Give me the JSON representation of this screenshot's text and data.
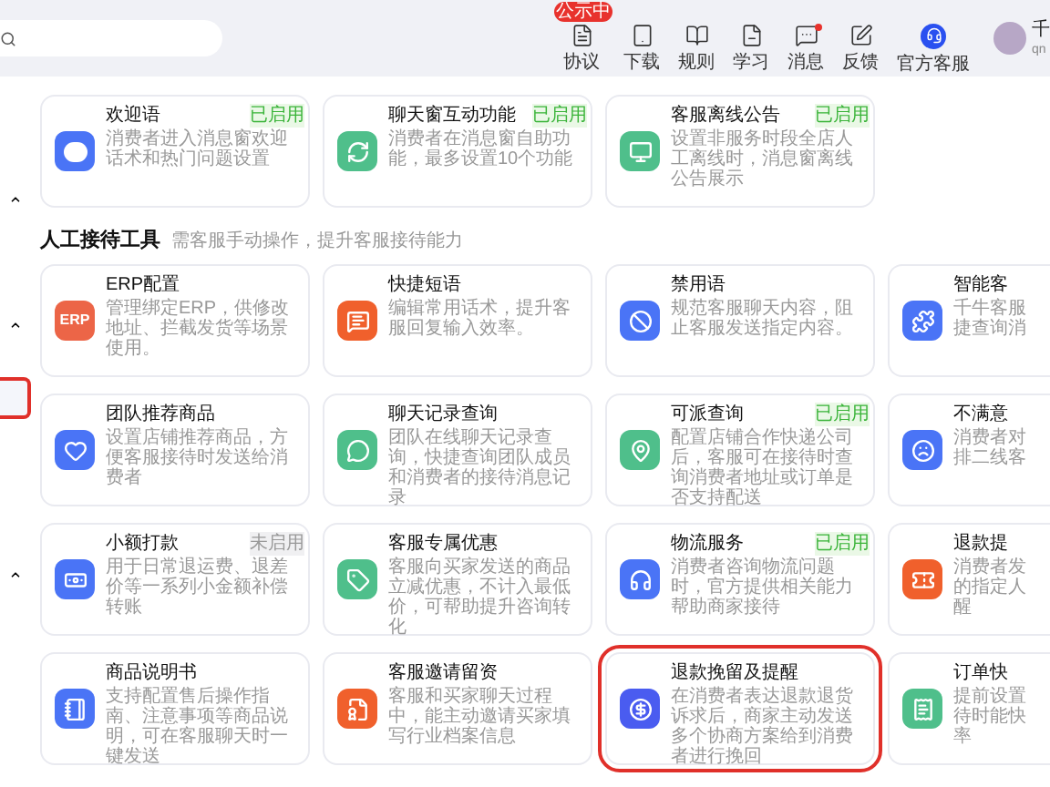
{
  "top_nav": [
    {
      "label": "协议",
      "badge": "公示中",
      "dot": false
    },
    {
      "label": "下载",
      "dot": false
    },
    {
      "label": "规则",
      "dot": false
    },
    {
      "label": "学习",
      "dot": false
    },
    {
      "label": "消息",
      "dot": true
    },
    {
      "label": "反馈",
      "dot": false
    },
    {
      "label": "官方客服",
      "dot": false
    }
  ],
  "user": {
    "name": "千",
    "account": "qn"
  },
  "sidebar": {
    "items": [
      {
        "selected": false
      },
      {
        "selected": false
      },
      {
        "selected": true
      },
      {
        "selected": false
      }
    ]
  },
  "top_cards": [
    {
      "title": "欢迎语",
      "desc": "消费者进入消息窗欢迎话术和热门问题设置",
      "status": "已启用",
      "enabled": true,
      "color": "#4a74f6",
      "highlighted": false
    },
    {
      "title": "聊天窗互动功能",
      "desc": "消费者在消息窗自助功能，最多设置10个功能",
      "status": "已启用",
      "enabled": true,
      "color": "#4fbf8b",
      "highlighted": false
    },
    {
      "title": "客服离线公告",
      "desc": "设置非服务时段全店人工离线时，消息窗离线公告展示",
      "status": "已启用",
      "enabled": true,
      "color": "#4fbf8b",
      "highlighted": false
    }
  ],
  "section": {
    "title": "人工接待工具",
    "subtitle": "需客服手动操作，提升客服接待能力"
  },
  "cards": [
    {
      "title": "ERP配置",
      "icon_text": "ERP",
      "desc": "管理绑定ERP，供修改地址、拦截发货等场景使用。",
      "color": "#ec6547",
      "highlighted": false
    },
    {
      "title": "快捷短语",
      "desc": "编辑常用话术，提升客服回复输入效率。",
      "color": "#f0602c",
      "highlighted": false
    },
    {
      "title": "禁用语",
      "desc": "规范客服聊天内容，阻止客服发送指定内容。",
      "color": "#4a74f6",
      "highlighted": false
    },
    {
      "title": "智能客",
      "desc": "千牛客服捷查询消",
      "color": "#4a74f6",
      "highlighted": false
    },
    {
      "title": "团队推荐商品",
      "desc": "设置店铺推荐商品，方便客服接待时发送给消费者",
      "color": "#4a74f6",
      "highlighted": false
    },
    {
      "title": "聊天记录查询",
      "desc": "团队在线聊天记录查询，快捷查询团队成员和消费者的接待消息记录",
      "color": "#4fbf8b",
      "highlighted": false
    },
    {
      "title": "可派查询",
      "desc": "配置店铺合作快递公司后，客服可在接待时查询消费者地址或订单是否支持配送",
      "status": "已启用",
      "enabled": true,
      "color": "#4fbf8b",
      "highlighted": false
    },
    {
      "title": "不满意",
      "desc": "消费者对排二线客",
      "color": "#4a74f6",
      "highlighted": false
    },
    {
      "title": "小额打款",
      "desc": "用于日常退运费、退差价等一系列小金额补偿转账",
      "status": "未启用",
      "enabled": false,
      "color": "#4a74f6",
      "highlighted": false
    },
    {
      "title": "客服专属优惠",
      "desc": "客服向买家发送的商品立减优惠，不计入最低价，可帮助提升咨询转化",
      "color": "#4fbf8b",
      "highlighted": false
    },
    {
      "title": "物流服务",
      "desc": "消费者咨询物流问题时，官方提供相关能力帮助商家接待",
      "status": "已启用",
      "enabled": true,
      "color": "#4a74f6",
      "highlighted": false
    },
    {
      "title": "退款提",
      "desc": "消费者发的指定人醒",
      "color": "#f0602c",
      "highlighted": false
    },
    {
      "title": "商品说明书",
      "desc": "支持配置售后操作指南、注意事项等商品说明，可在客服聊天时一键发送",
      "color": "#4a74f6",
      "highlighted": false
    },
    {
      "title": "客服邀请留资",
      "desc": "客服和买家聊天过程中，能主动邀请买家填写行业档案信息",
      "color": "#f0602c",
      "highlighted": false
    },
    {
      "title": "退款挽留及提醒",
      "desc": "在消费者表达退款退货诉求后，商家主动发送多个协商方案给到消费者进行挽回",
      "color": "#4a5cf0",
      "highlighted": true
    },
    {
      "title": "订单快",
      "desc": "提前设置待时能快率",
      "color": "#4fbf8b",
      "highlighted": false
    }
  ]
}
